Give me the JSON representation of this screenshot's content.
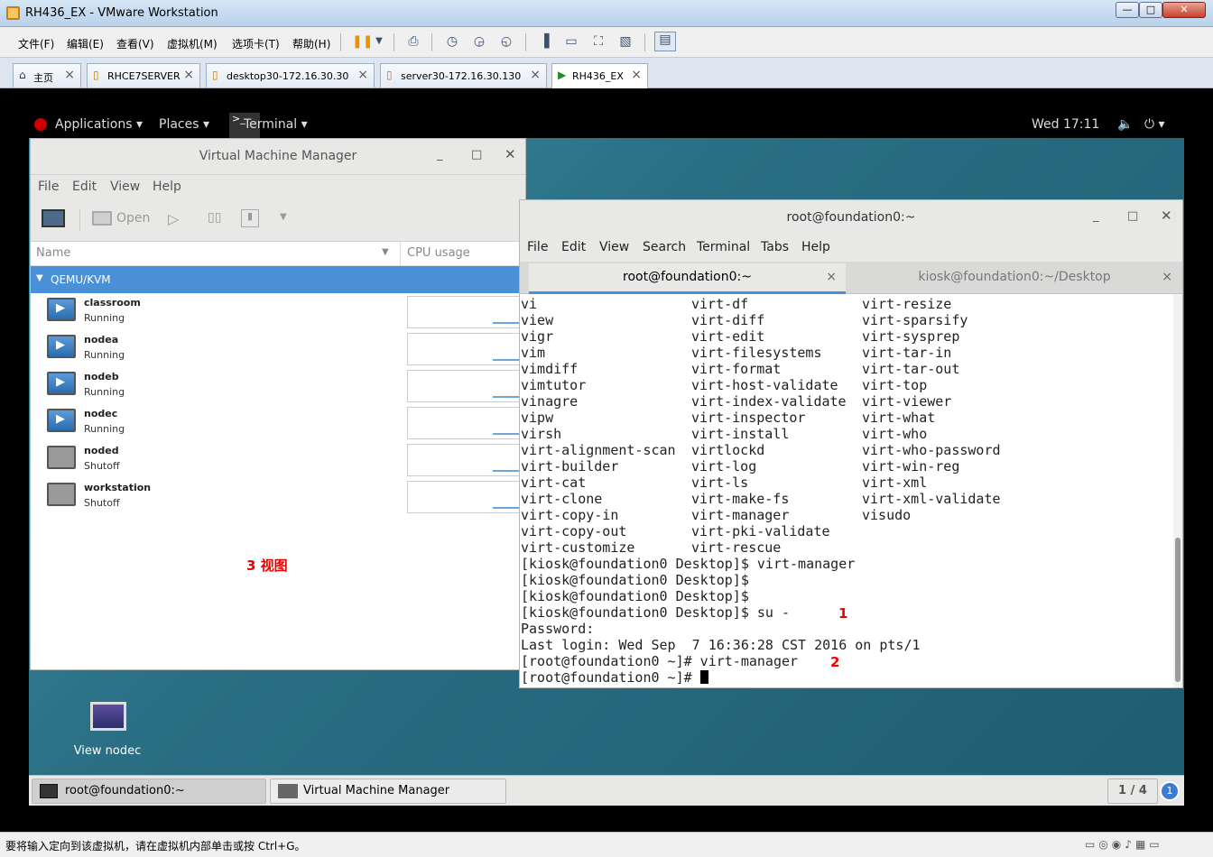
{
  "vmware": {
    "title": "RH436_EX - VMware Workstation",
    "window_controls": {
      "minimize": "—",
      "maximize": "□",
      "close": "✕"
    },
    "menu": [
      "文件(F)",
      "编辑(E)",
      "查看(V)",
      "虚拟机(M)",
      "选项卡(T)",
      "帮助(H)"
    ],
    "toolbar_icons": [
      "pause-icon",
      "dropdown-icon",
      "send-keys-icon",
      "snapshot-take-icon",
      "snapshot-revert-icon",
      "snapshot-manager-icon",
      "show-library-icon",
      "console-view-icon",
      "fullscreen-icon",
      "unity-icon",
      "thumbnail-view-icon"
    ],
    "tabs": [
      {
        "label": "主页",
        "icon": "home-icon",
        "active": false
      },
      {
        "label": "RHCE7SERVER",
        "icon": "vm-icon",
        "active": false
      },
      {
        "label": "desktop30-172.16.30.30",
        "icon": "vm-icon",
        "active": false
      },
      {
        "label": "server30-172.16.30.130",
        "icon": "vm-icon",
        "active": false
      },
      {
        "label": "RH436_EX",
        "icon": "vm-running-icon",
        "active": true
      }
    ],
    "status_text": "要将输入定向到该虚拟机，请在虚拟机内部单击或按 Ctrl+G。"
  },
  "gnome": {
    "applications": "Applications",
    "places": "Places",
    "terminal": "Terminal",
    "clock": "Wed 17:11",
    "workspace": "1 / 4"
  },
  "vmm": {
    "title": "Virtual Machine Manager",
    "menu": [
      "File",
      "Edit",
      "View",
      "Help"
    ],
    "open_label": "Open",
    "col_name": "Name",
    "col_cpu": "CPU usage",
    "group": "QEMU/KVM",
    "vms": [
      {
        "name": "classroom",
        "status": "Running",
        "running": true
      },
      {
        "name": "nodea",
        "status": "Running",
        "running": true
      },
      {
        "name": "nodeb",
        "status": "Running",
        "running": true
      },
      {
        "name": "nodec",
        "status": "Running",
        "running": true
      },
      {
        "name": "noded",
        "status": "Shutoff",
        "running": false
      },
      {
        "name": "workstation",
        "status": "Shutoff",
        "running": false
      }
    ],
    "annotation": "3  视图"
  },
  "terminal": {
    "title": "root@foundation0:~",
    "menu": [
      "File",
      "Edit",
      "View",
      "Search",
      "Terminal",
      "Tabs",
      "Help"
    ],
    "tab1": "root@foundation0:~",
    "tab2": "kiosk@foundation0:~/Desktop",
    "completion_rows": [
      [
        "vi",
        "virt-df",
        "virt-resize"
      ],
      [
        "view",
        "virt-diff",
        "virt-sparsify"
      ],
      [
        "vigr",
        "virt-edit",
        "virt-sysprep"
      ],
      [
        "vim",
        "virt-filesystems",
        "virt-tar-in"
      ],
      [
        "vimdiff",
        "virt-format",
        "virt-tar-out"
      ],
      [
        "vimtutor",
        "virt-host-validate",
        "virt-top"
      ],
      [
        "vinagre",
        "virt-index-validate",
        "virt-viewer"
      ],
      [
        "vipw",
        "virt-inspector",
        "virt-what"
      ],
      [
        "virsh",
        "virt-install",
        "virt-who"
      ],
      [
        "virt-alignment-scan",
        "virtlockd",
        "virt-who-password"
      ],
      [
        "virt-builder",
        "virt-log",
        "virt-win-reg"
      ],
      [
        "virt-cat",
        "virt-ls",
        "virt-xml"
      ],
      [
        "virt-clone",
        "virt-make-fs",
        "virt-xml-validate"
      ],
      [
        "virt-copy-in",
        "virt-manager",
        "visudo"
      ],
      [
        "virt-copy-out",
        "virt-pki-validate",
        ""
      ],
      [
        "virt-customize",
        "virt-rescue",
        ""
      ]
    ],
    "lines": [
      "[kiosk@foundation0 Desktop]$ virt-manager",
      "[kiosk@foundation0 Desktop]$",
      "[kiosk@foundation0 Desktop]$",
      "[kiosk@foundation0 Desktop]$ su -",
      "Password:",
      "Last login: Wed Sep  7 16:36:28 CST 2016 on pts/1",
      "[root@foundation0 ~]# virt-manager",
      "[root@foundation0 ~]# "
    ],
    "annotation1": "1",
    "annotation2": "2"
  },
  "desktop": {
    "icon_label": "View nodec"
  },
  "taskbar": {
    "item1": "root@foundation0:~",
    "item2": "Virtual Machine Manager"
  }
}
